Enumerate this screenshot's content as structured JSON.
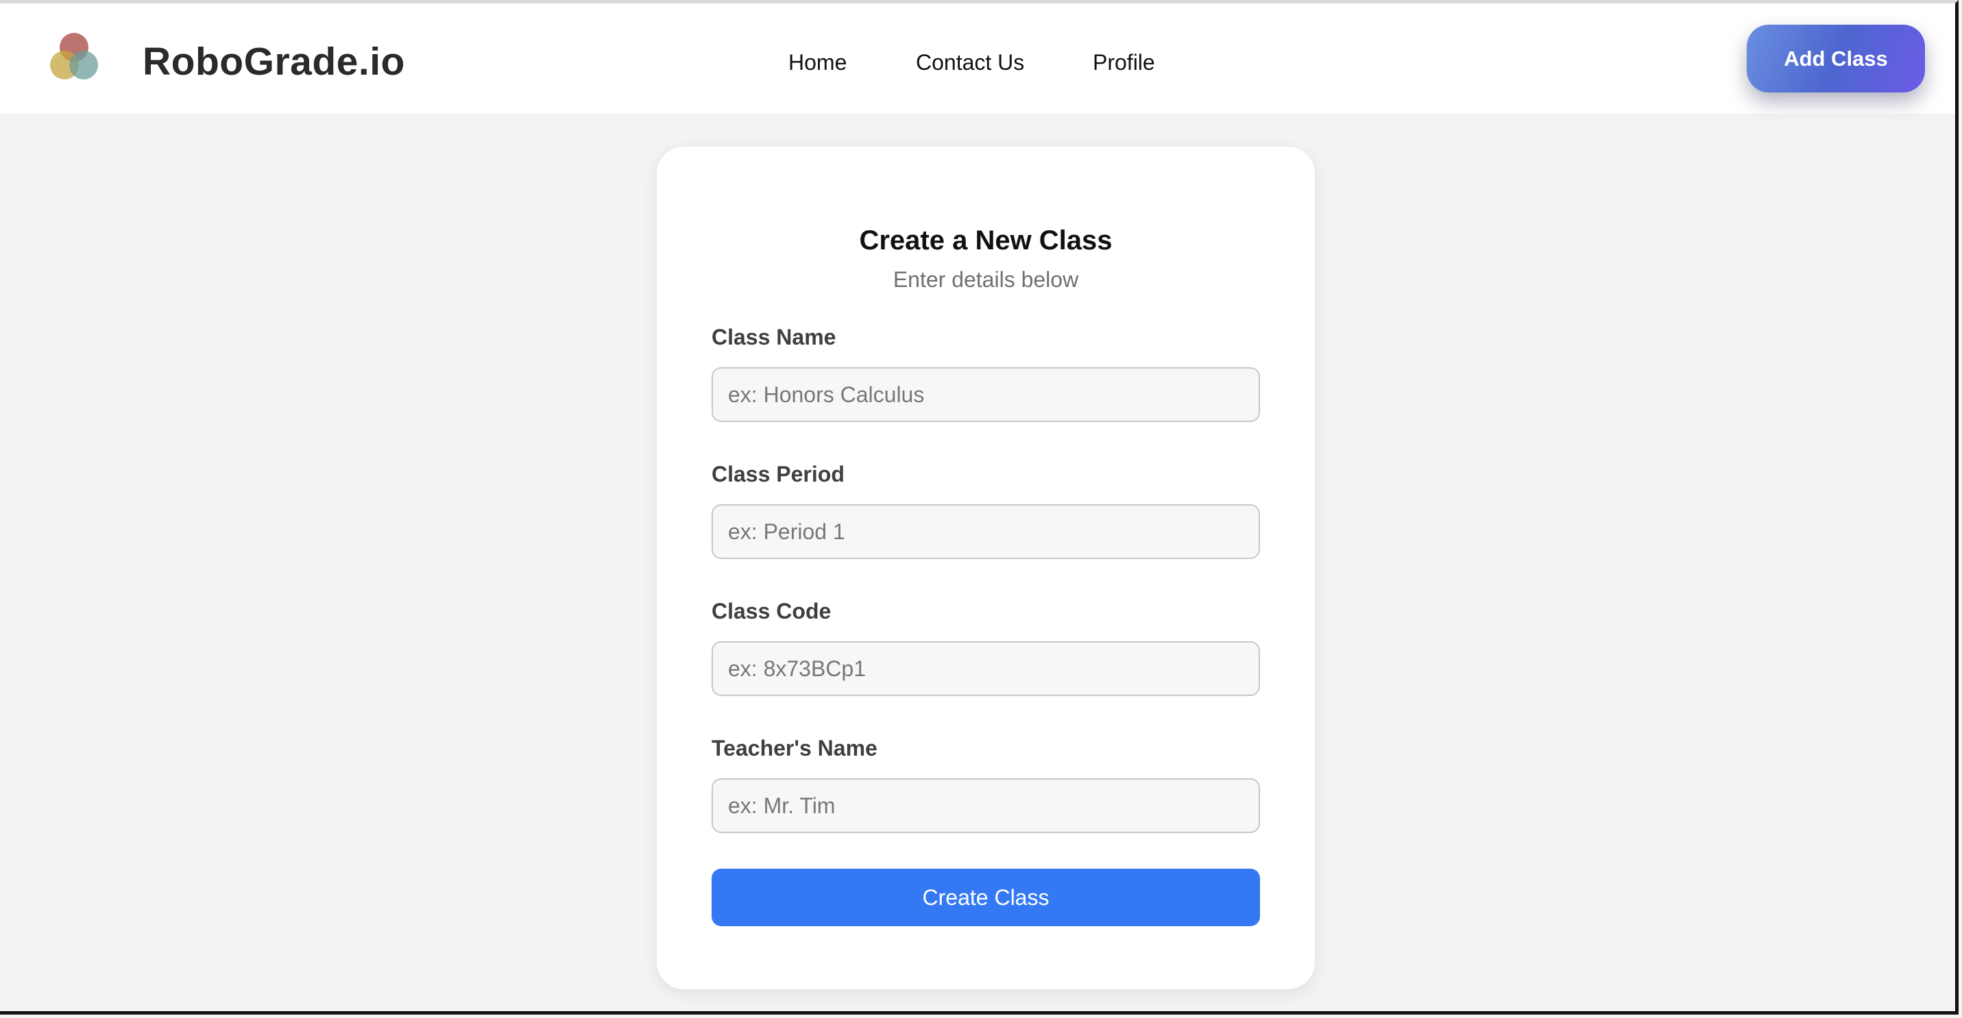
{
  "header": {
    "brand": "RoboGrade.io",
    "nav": [
      {
        "label": "Home"
      },
      {
        "label": "Contact Us"
      },
      {
        "label": "Profile"
      }
    ],
    "add_class_label": "Add Class",
    "logo_icon": "tri-circle-logo-icon"
  },
  "form": {
    "title": "Create a New Class",
    "subtitle": "Enter details below",
    "fields": [
      {
        "label": "Class Name",
        "placeholder": "ex: Honors Calculus",
        "value": ""
      },
      {
        "label": "Class Period",
        "placeholder": "ex: Period 1",
        "value": ""
      },
      {
        "label": "Class Code",
        "placeholder": "ex: 8x73BCp1",
        "value": ""
      },
      {
        "label": "Teacher's Name",
        "placeholder": "ex: Mr. Tim",
        "value": ""
      }
    ],
    "submit_label": "Create Class"
  },
  "colors": {
    "primary": "#3479f3",
    "add_class_gradient_start": "#6a8ee0",
    "add_class_gradient_end": "#6c5be6",
    "page_background": "#f3f3f3"
  }
}
